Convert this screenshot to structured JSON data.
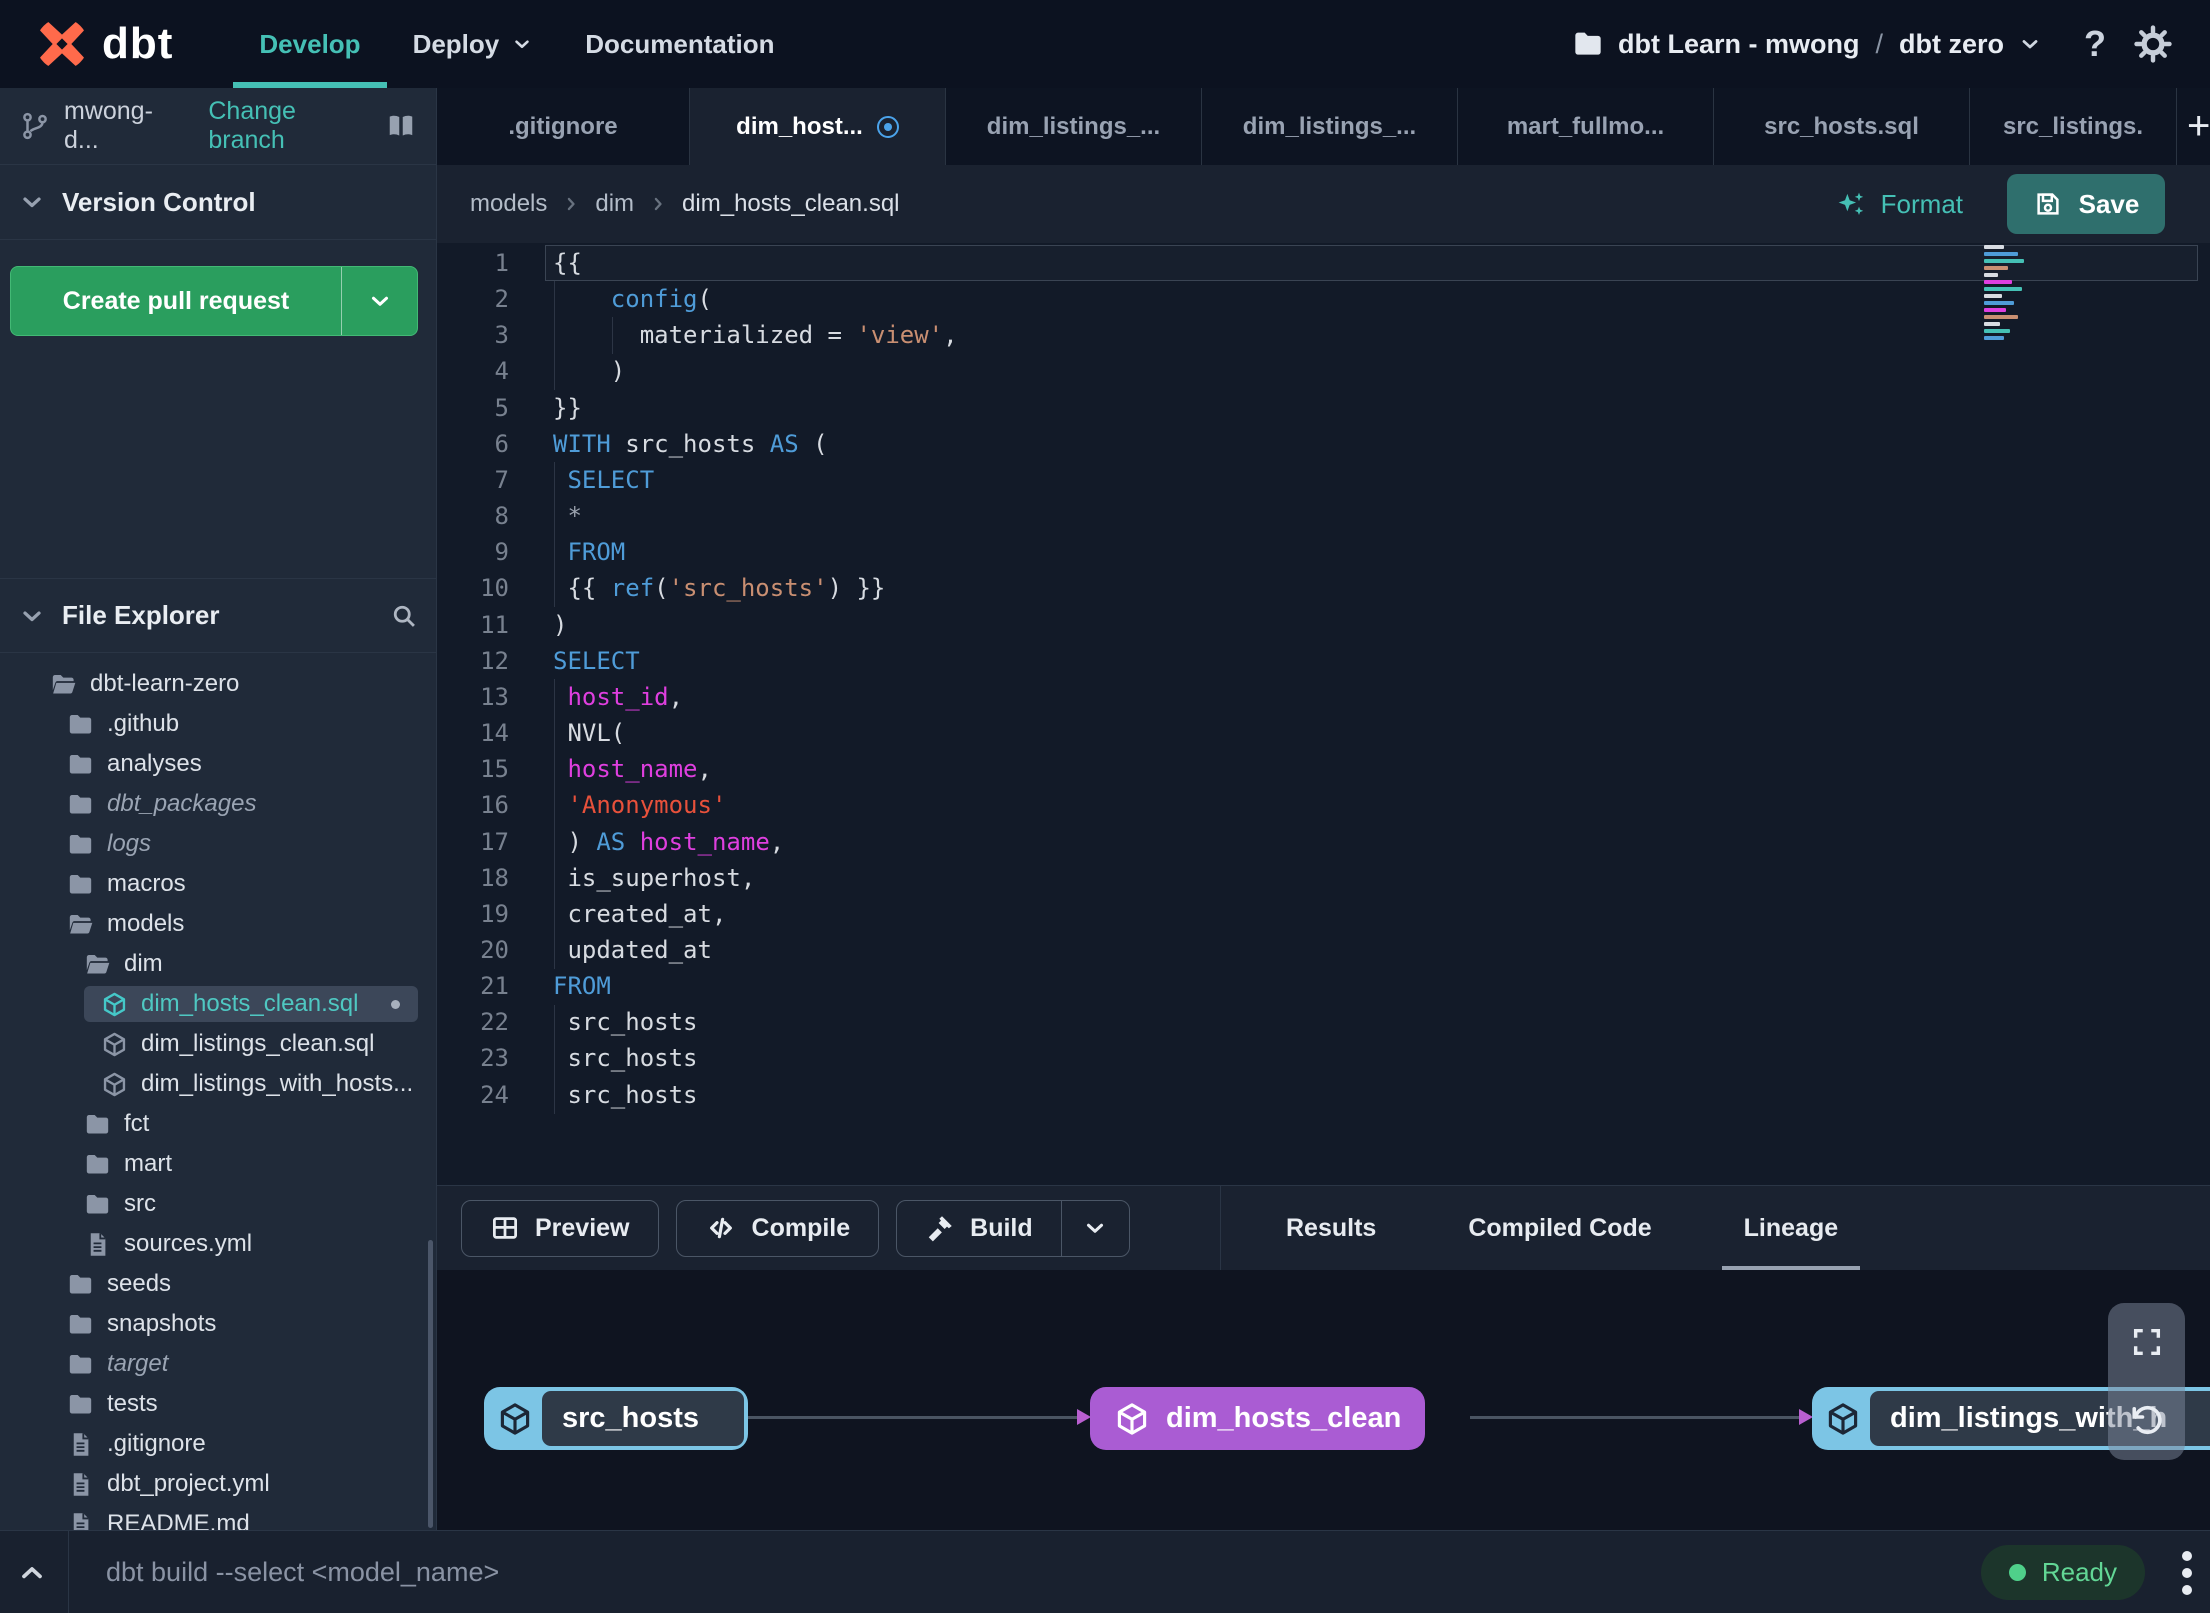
{
  "colors": {
    "teal": "#45c0b5",
    "green": "#2a9e5e",
    "save_teal": "#2f6f6d",
    "purple": "#aa5cd3",
    "node_blue": "#7cc5e5",
    "ready_green": "#62d695",
    "kw": "#4f9cd8",
    "str": "#c98f72",
    "str_red": "#e8513b",
    "ident": "#df3fdf",
    "modified_blue": "#4ba3ea",
    "logo_orange": "#ff6a4b"
  },
  "nav": {
    "brand": "dbt",
    "develop": "Develop",
    "deploy": "Deploy",
    "documentation": "Documentation",
    "project_name": "dbt Learn - mwong",
    "project_sep": "/",
    "environment": "dbt zero",
    "help_glyph": "?"
  },
  "sidebar": {
    "branch_name": "mwong-d...",
    "change_branch": "Change branch",
    "version_control_title": "Version Control",
    "create_pr_label": "Create pull request",
    "file_explorer_title": "File Explorer",
    "tree": [
      {
        "label": "dbt-learn-zero",
        "icon": "folder-open",
        "depth": 0
      },
      {
        "label": ".github",
        "icon": "folder",
        "depth": 1
      },
      {
        "label": "analyses",
        "icon": "folder",
        "depth": 1
      },
      {
        "label": "dbt_packages",
        "icon": "folder",
        "depth": 1,
        "italic": true
      },
      {
        "label": "logs",
        "icon": "folder",
        "depth": 1,
        "italic": true
      },
      {
        "label": "macros",
        "icon": "folder",
        "depth": 1
      },
      {
        "label": "models",
        "icon": "folder-open",
        "depth": 1
      },
      {
        "label": "dim",
        "icon": "folder-open",
        "depth": 2
      },
      {
        "label": "dim_hosts_clean.sql",
        "icon": "model",
        "depth": 3,
        "selected": true,
        "modified": true
      },
      {
        "label": "dim_listings_clean.sql",
        "icon": "model",
        "depth": 3
      },
      {
        "label": "dim_listings_with_hosts...",
        "icon": "model",
        "depth": 3
      },
      {
        "label": "fct",
        "icon": "folder",
        "depth": 2
      },
      {
        "label": "mart",
        "icon": "folder",
        "depth": 2
      },
      {
        "label": "src",
        "icon": "folder",
        "depth": 2
      },
      {
        "label": "sources.yml",
        "icon": "file",
        "depth": 2
      },
      {
        "label": "seeds",
        "icon": "folder",
        "depth": 1
      },
      {
        "label": "snapshots",
        "icon": "folder",
        "depth": 1
      },
      {
        "label": "target",
        "icon": "folder",
        "depth": 1,
        "italic": true
      },
      {
        "label": "tests",
        "icon": "folder",
        "depth": 1
      },
      {
        "label": ".gitignore",
        "icon": "file",
        "depth": 1
      },
      {
        "label": "dbt_project.yml",
        "icon": "file",
        "depth": 1
      },
      {
        "label": "README.md",
        "icon": "file",
        "depth": 1
      }
    ]
  },
  "tabs": {
    "items": [
      {
        "label": ".gitignore"
      },
      {
        "label": "dim_host...",
        "active": true,
        "modified": true
      },
      {
        "label": "dim_listings_..."
      },
      {
        "label": "dim_listings_..."
      },
      {
        "label": "mart_fullmo..."
      },
      {
        "label": "src_hosts.sql"
      },
      {
        "label": "src_listings."
      }
    ],
    "add_glyph": "+"
  },
  "editor": {
    "breadcrumb": [
      "models",
      "dim",
      "dim_hosts_clean.sql"
    ],
    "format_label": "Format",
    "save_label": "Save",
    "current_line": 1,
    "lines": [
      [
        [
          "p",
          "{{"
        ]
      ],
      [
        [
          "p",
          "    "
        ],
        [
          "k",
          "config"
        ],
        [
          "p",
          "("
        ]
      ],
      [
        [
          "p",
          "      materialized = "
        ],
        [
          "s",
          "'view'"
        ],
        [
          "p",
          ","
        ]
      ],
      [
        [
          "p",
          "    )"
        ]
      ],
      [
        [
          "p",
          "}}"
        ]
      ],
      [
        [
          "k",
          "WITH"
        ],
        [
          "p",
          " src_hosts "
        ],
        [
          "k",
          "AS"
        ],
        [
          "p",
          " ("
        ]
      ],
      [
        [
          "p",
          " "
        ],
        [
          "k",
          "SELECT"
        ]
      ],
      [
        [
          "p",
          " "
        ],
        [
          "g",
          "*"
        ]
      ],
      [
        [
          "p",
          " "
        ],
        [
          "k",
          "FROM"
        ]
      ],
      [
        [
          "p",
          " {{ "
        ],
        [
          "k",
          "ref"
        ],
        [
          "p",
          "("
        ],
        [
          "s",
          "'src_hosts'"
        ],
        [
          "p",
          ") }}"
        ]
      ],
      [
        [
          "p",
          ")"
        ]
      ],
      [
        [
          "k",
          "SELECT"
        ]
      ],
      [
        [
          "p",
          " "
        ],
        [
          "m",
          "host_id"
        ],
        [
          "p",
          ","
        ]
      ],
      [
        [
          "p",
          " NVL("
        ]
      ],
      [
        [
          "p",
          " "
        ],
        [
          "m",
          "host_name"
        ],
        [
          "p",
          ","
        ]
      ],
      [
        [
          "p",
          " "
        ],
        [
          "r",
          "'Anonymous'"
        ]
      ],
      [
        [
          "p",
          " ) "
        ],
        [
          "k",
          "AS"
        ],
        [
          "p",
          " "
        ],
        [
          "m",
          "host_name"
        ],
        [
          "p",
          ","
        ]
      ],
      [
        [
          "p",
          " is_superhost,"
        ]
      ],
      [
        [
          "p",
          " created_at,"
        ]
      ],
      [
        [
          "p",
          " updated_at"
        ]
      ],
      [
        [
          "k",
          "FROM"
        ]
      ],
      [
        [
          "p",
          " src_hosts"
        ]
      ],
      [
        [
          "p",
          " src_hosts"
        ]
      ],
      [
        [
          "p",
          " src_hosts"
        ]
      ]
    ]
  },
  "panel": {
    "preview_label": "Preview",
    "compile_label": "Compile",
    "build_label": "Build",
    "tabs": [
      {
        "label": "Results"
      },
      {
        "label": "Compiled Code"
      },
      {
        "label": "Lineage",
        "active": true
      }
    ]
  },
  "lineage": {
    "nodes": [
      {
        "label": "src_hosts",
        "kind": "source"
      },
      {
        "label": "dim_hosts_clean",
        "kind": "model"
      },
      {
        "label": "dim_listings_with_h",
        "kind": "source"
      }
    ]
  },
  "statusbar": {
    "command": "dbt build --select <model_name>",
    "status": "Ready"
  }
}
